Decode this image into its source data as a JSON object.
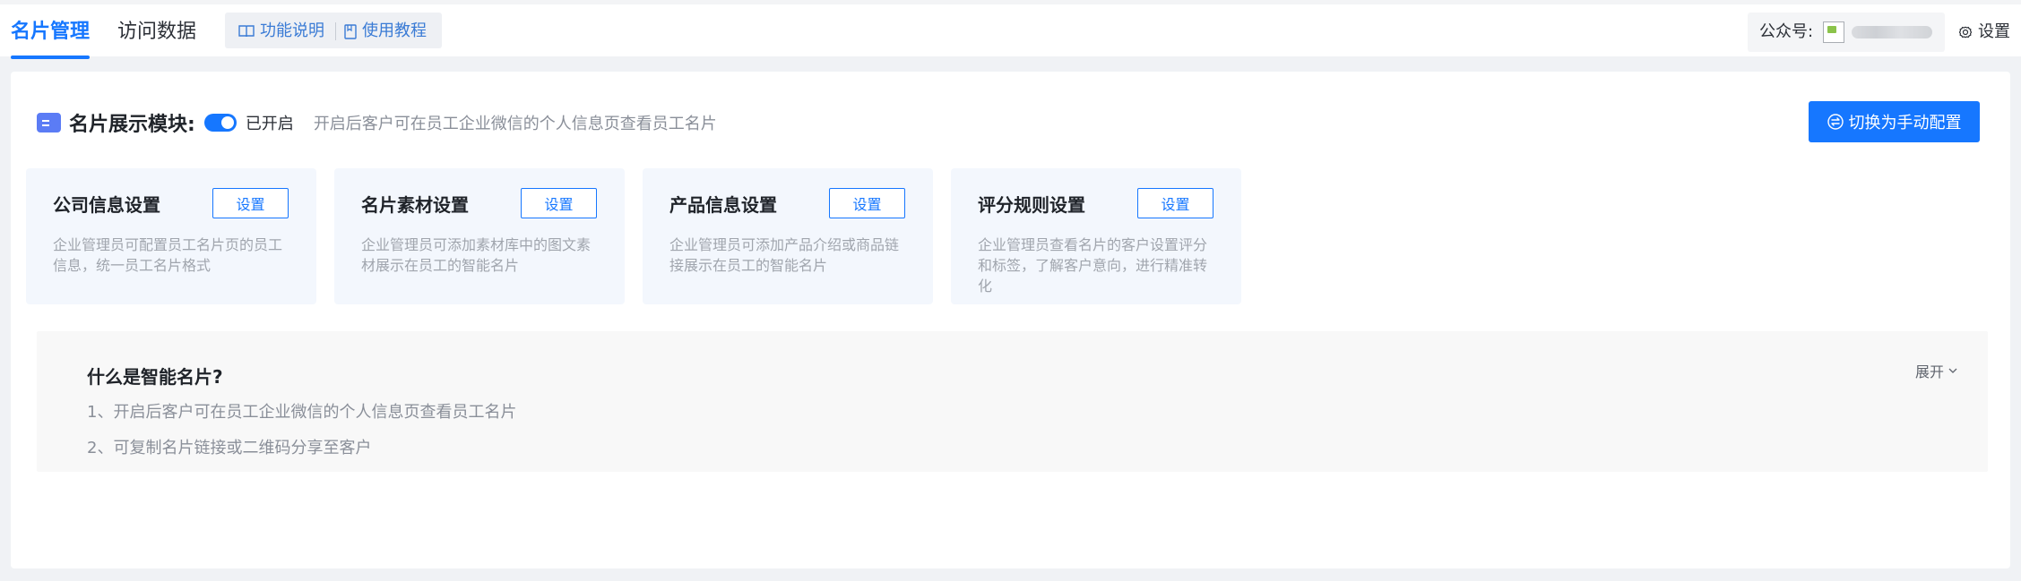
{
  "tabs": [
    {
      "label": "名片管理",
      "active": true
    },
    {
      "label": "访问数据",
      "active": false
    }
  ],
  "help_links": {
    "feature_label": "功能说明",
    "tutorial_label": "使用教程"
  },
  "account": {
    "label": "公众号:"
  },
  "settings_label": "设置",
  "module": {
    "title": "名片展示模块:",
    "toggle_on": true,
    "toggle_label": "已开启",
    "description": "开启后客户可在员工企业微信的个人信息页查看员工名片"
  },
  "switch_button_label": "切换为手动配置",
  "cards": [
    {
      "title": "公司信息设置",
      "button": "设置",
      "description": "企业管理员可配置员工名片页的员工信息，统一员工名片格式"
    },
    {
      "title": "名片素材设置",
      "button": "设置",
      "description": "企业管理员可添加素材库中的图文素材展示在员工的智能名片"
    },
    {
      "title": "产品信息设置",
      "button": "设置",
      "description": "企业管理员可添加产品介绍或商品链接展示在员工的智能名片"
    },
    {
      "title": "评分规则设置",
      "button": "设置",
      "description": "企业管理员查看名片的客户设置评分和标签，了解客户意向，进行精准转化"
    }
  ],
  "info": {
    "title": "什么是智能名片?",
    "lines": [
      "1、开启后客户可在员工企业微信的个人信息页查看员工名片",
      "2、可复制名片链接或二维码分享至客户"
    ],
    "expand_label": "展开"
  },
  "colors": {
    "primary": "#1677ff",
    "card_bg": "#f3f7fd",
    "muted_text": "#8a8f99"
  }
}
